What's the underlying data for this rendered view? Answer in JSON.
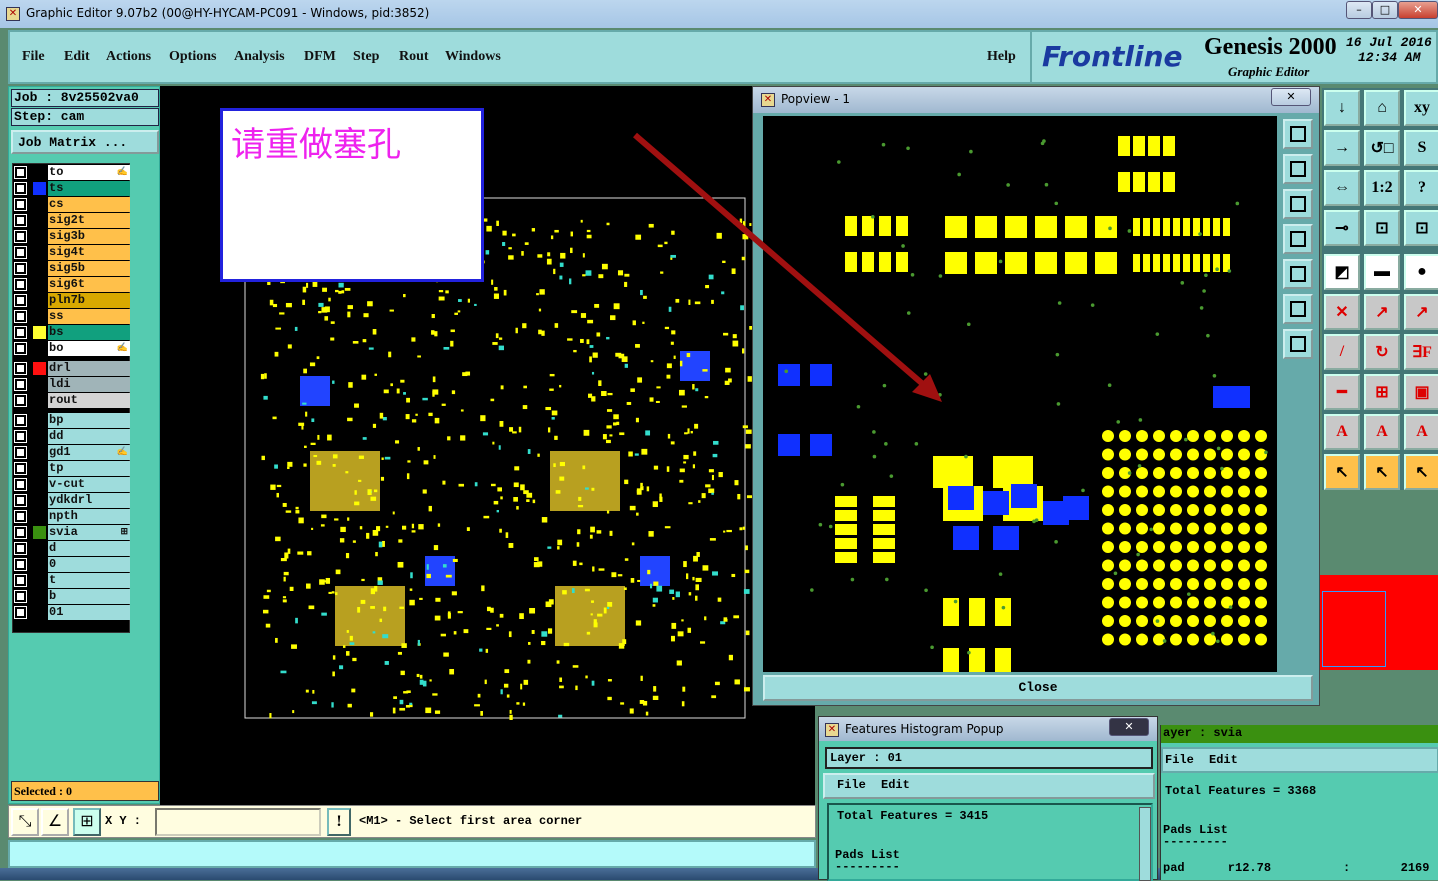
{
  "window": {
    "title": "Graphic Editor 9.07b2 (00@HY-HYCAM-PC091 - Windows, pid:3852)",
    "min": "–",
    "max": "□",
    "close": "✕"
  },
  "menu": {
    "items": [
      "File",
      "Edit",
      "Actions",
      "Options",
      "Analysis",
      "DFM",
      "Step",
      "Rout",
      "Windows"
    ],
    "help": "Help"
  },
  "brand": {
    "logo": "Frontline",
    "product": "Genesis 2000",
    "subtitle": "Graphic Editor",
    "date": "16 Jul 2016",
    "time": "12:34 AM"
  },
  "job": {
    "job_label": "Job : 8v25502va0",
    "step_label": "Step: cam",
    "matrix_button": "Job Matrix ..."
  },
  "layers": [
    {
      "name": "to",
      "bg": "#ffffff",
      "swatch": "",
      "mark": "✍"
    },
    {
      "name": "ts",
      "bg": "#11a07e",
      "swatch": "#1030ff",
      "mark": ""
    },
    {
      "name": "cs",
      "bg": "#ffc04a",
      "swatch": "",
      "mark": ""
    },
    {
      "name": "sig2t",
      "bg": "#ffc04a",
      "swatch": "",
      "mark": ""
    },
    {
      "name": "sig3b",
      "bg": "#ffc04a",
      "swatch": "",
      "mark": ""
    },
    {
      "name": "sig4t",
      "bg": "#ffc04a",
      "swatch": "",
      "mark": ""
    },
    {
      "name": "sig5b",
      "bg": "#ffc04a",
      "swatch": "",
      "mark": ""
    },
    {
      "name": "sig6t",
      "bg": "#ffc04a",
      "swatch": "",
      "mark": ""
    },
    {
      "name": "pln7b",
      "bg": "#d8a800",
      "swatch": "",
      "mark": ""
    },
    {
      "name": "ss",
      "bg": "#ffc04a",
      "swatch": "",
      "mark": ""
    },
    {
      "name": "bs",
      "bg": "#11a07e",
      "swatch": "#ffff30",
      "mark": ""
    },
    {
      "name": "bo",
      "bg": "#ffffff",
      "swatch": "",
      "mark": "✍"
    },
    {
      "name": "drl",
      "bg": "#a0b4b8",
      "swatch": "#ff1010",
      "mark": ""
    },
    {
      "name": "ldi",
      "bg": "#a0b4b8",
      "swatch": "",
      "mark": ""
    },
    {
      "name": "rout",
      "bg": "#d4d4d4",
      "swatch": "",
      "mark": ""
    },
    {
      "name": "bp",
      "bg": "#9edcdc",
      "swatch": "",
      "mark": ""
    },
    {
      "name": "dd",
      "bg": "#9edcdc",
      "swatch": "",
      "mark": ""
    },
    {
      "name": "gd1",
      "bg": "#9edcdc",
      "swatch": "",
      "mark": "✍"
    },
    {
      "name": "tp",
      "bg": "#9edcdc",
      "swatch": "",
      "mark": ""
    },
    {
      "name": "v-cut",
      "bg": "#9edcdc",
      "swatch": "",
      "mark": ""
    },
    {
      "name": "ydkdrl",
      "bg": "#9edcdc",
      "swatch": "",
      "mark": ""
    },
    {
      "name": "npth",
      "bg": "#9edcdc",
      "swatch": "",
      "mark": ""
    },
    {
      "name": "svia",
      "bg": "#9edcdc",
      "swatch": "#3a9010",
      "mark": "⊞"
    },
    {
      "name": "d",
      "bg": "#9edcdc",
      "swatch": "",
      "mark": ""
    },
    {
      "name": "0",
      "bg": "#9edcdc",
      "swatch": "",
      "mark": ""
    },
    {
      "name": "t",
      "bg": "#9edcdc",
      "swatch": "",
      "mark": ""
    },
    {
      "name": "b",
      "bg": "#9edcdc",
      "swatch": "",
      "mark": ""
    },
    {
      "name": "01",
      "bg": "#9edcdc",
      "swatch": "",
      "mark": ""
    }
  ],
  "selected": "Selected : 0",
  "note": "请重做塞孔",
  "bottom": {
    "xy_label": "X Y :",
    "xy_value": "",
    "warn": "!",
    "prompt": "<M1> - Select first area corner"
  },
  "popview": {
    "title": "Popview - 1",
    "close": "Close"
  },
  "histogram": {
    "title": "Features Histogram Popup",
    "layer": "Layer :  01",
    "menu": [
      "File",
      "Edit"
    ],
    "total": "Total Features = 3415",
    "pads": "Pads List",
    "dash": "---------"
  },
  "histogram2": {
    "layer": "ayer :  svia",
    "menu": [
      "File",
      "Edit"
    ],
    "total": "Total Features = 3368",
    "pads": "Pads List",
    "dash": "---------",
    "row": "pad      r12.78          :       2169"
  },
  "toolbar": [
    "↓",
    "⌂",
    "xy",
    "→",
    "↺□",
    "S",
    "⇔",
    "1:2",
    "?",
    "⊸",
    "⊡",
    "⊡",
    "◩",
    "▬",
    "●",
    "✕",
    "↗",
    "↗",
    "/",
    "↻",
    "∃F",
    "━",
    "⊞",
    "▣",
    "A",
    "A",
    "A",
    "↖",
    "↖",
    "↖"
  ],
  "colors": {
    "accent": "#9edcdc",
    "panel": "#55cbb0",
    "pad": "#ffff00",
    "blue": "#1030ff",
    "arrow": "#a01010"
  }
}
